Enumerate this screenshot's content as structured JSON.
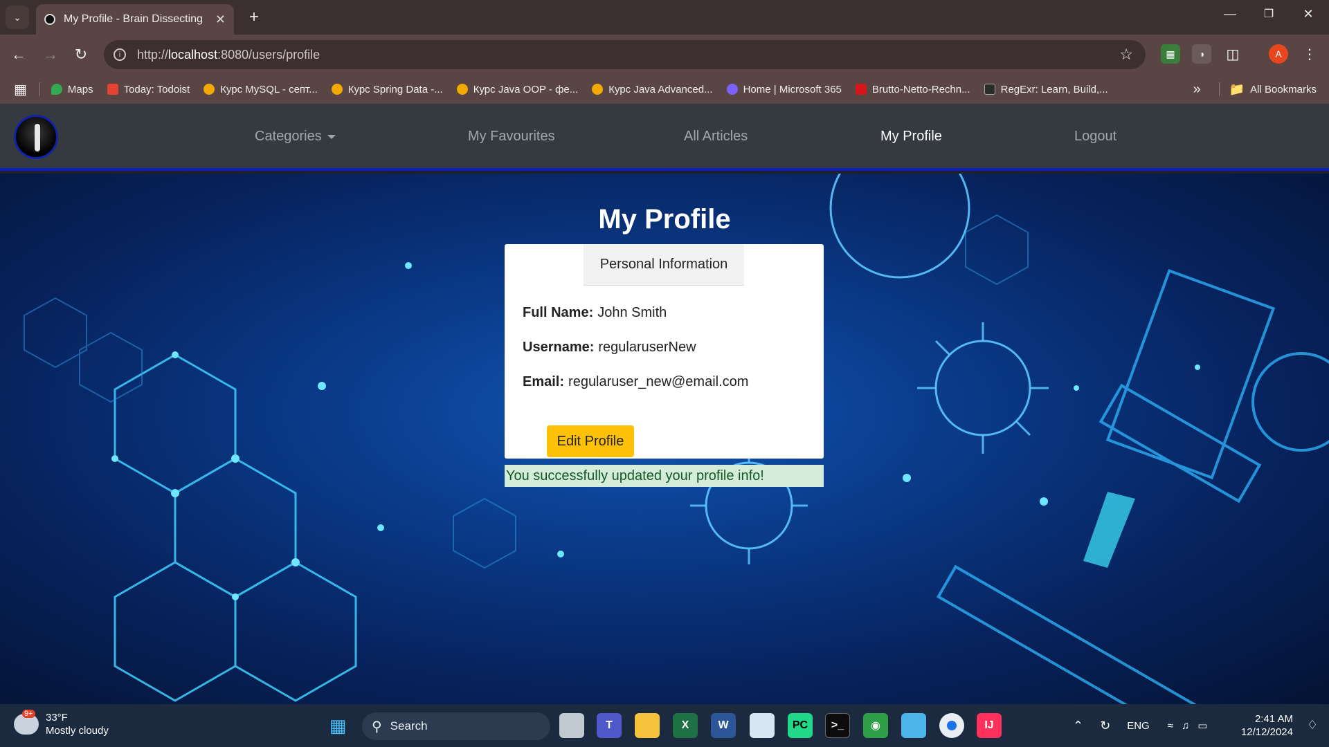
{
  "browser": {
    "tab_title": "My Profile - Brain Dissecting",
    "url_prefix": "http://",
    "url_host": "localhost",
    "url_path": ":8080/users/profile",
    "avatar_letter": "A",
    "bookmarks": [
      {
        "label": "Maps",
        "color": "#34a853"
      },
      {
        "label": "Today: Todoist",
        "color": "#e44332"
      },
      {
        "label": "Курс MySQL - септ...",
        "color": "#f2a900"
      },
      {
        "label": "Курс Spring Data -...",
        "color": "#f2a900"
      },
      {
        "label": "Курс Java OOP - фе...",
        "color": "#f2a900"
      },
      {
        "label": "Курс Java Advanced...",
        "color": "#f2a900"
      },
      {
        "label": "Home | Microsoft 365",
        "color": "#7b61ff"
      },
      {
        "label": "Brutto-Netto-Rechn...",
        "color": "#d6161a"
      },
      {
        "label": "RegExr: Learn, Build,...",
        "color": "#2b2b2b"
      }
    ],
    "all_bookmarks": "All Bookmarks"
  },
  "nav": {
    "categories": "Categories",
    "favourites": "My Favourites",
    "articles": "All Articles",
    "profile": "My Profile",
    "logout": "Logout"
  },
  "profile": {
    "title": "My Profile",
    "tab_label": "Personal Information",
    "full_name_label": "Full Name:",
    "full_name": "John Smith",
    "username_label": "Username:",
    "username": "regularuserNew",
    "email_label": "Email:",
    "email": "regularuser_new@email.com",
    "edit_button": "Edit Profile",
    "success_message": "You successfully updated your profile info!"
  },
  "taskbar": {
    "weather_badge": "9+",
    "temperature": "33°F",
    "weather_text": "Mostly cloudy",
    "search_label": "Search",
    "language": "ENG",
    "time": "2:41 AM",
    "date": "12/12/2024"
  },
  "colors": {
    "nav_bg": "#343a40",
    "nav_accent": "#0b1cc9",
    "button_bg": "#ffc107",
    "success_bg": "#d4edda",
    "success_text": "#155724"
  }
}
